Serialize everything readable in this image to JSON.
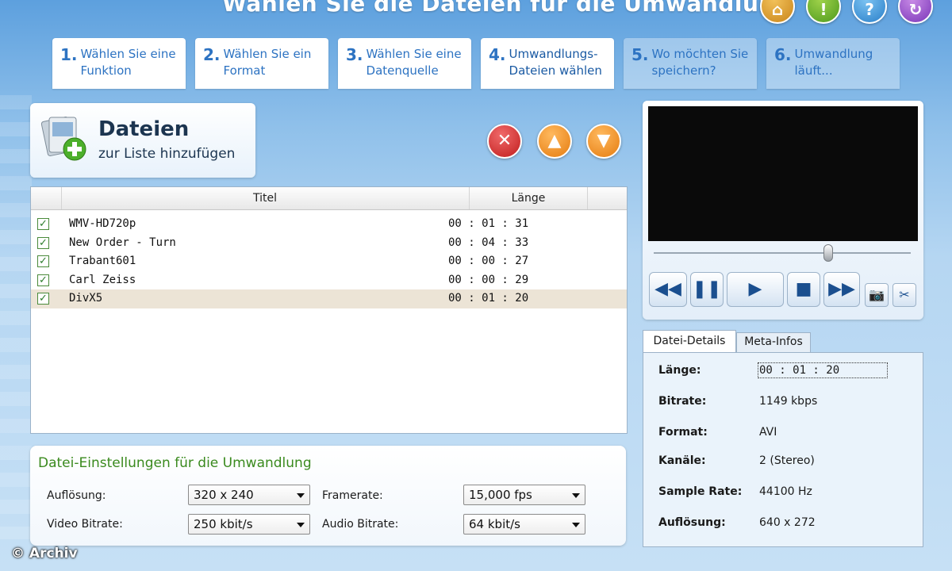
{
  "app": {
    "title": "Wählen Sie die Dateien für die Umwandlung",
    "top_icons": [
      "home-icon",
      "info-icon",
      "help-icon",
      "exit-icon"
    ]
  },
  "steps": [
    {
      "num": "1.",
      "label": "Wählen Sie eine\nFunktion",
      "state": "done"
    },
    {
      "num": "2.",
      "label": "Wählen Sie ein\nFormat",
      "state": "done"
    },
    {
      "num": "3.",
      "label": "Wählen Sie eine\nDatenquelle",
      "state": "done"
    },
    {
      "num": "4.",
      "label": "Umwandlungs-\nDateien wählen",
      "state": "active"
    },
    {
      "num": "5.",
      "label": "Wo möchten Sie\nspeichern?",
      "state": "disabled"
    },
    {
      "num": "6.",
      "label": "Umwandlung\nläuft...",
      "state": "disabled"
    }
  ],
  "add_files": {
    "title": "Dateien",
    "subtitle": "zur Liste hinzufügen"
  },
  "list": {
    "columns": {
      "title": "Titel",
      "length": "Länge"
    },
    "rows": [
      {
        "title": "WMV-HD720p",
        "length": "00 : 01 : 31",
        "checked": true,
        "selected": false
      },
      {
        "title": "New Order - Turn",
        "length": "00 : 04 : 33",
        "checked": true,
        "selected": false
      },
      {
        "title": "Trabant601",
        "length": "00 : 00 : 27",
        "checked": true,
        "selected": false
      },
      {
        "title": "Carl Zeiss",
        "length": "00 : 00 : 29",
        "checked": true,
        "selected": false
      },
      {
        "title": "DivX5",
        "length": "00 : 01 : 20",
        "checked": true,
        "selected": true
      }
    ]
  },
  "settings": {
    "title": "Datei-Einstellungen für die Umwandlung",
    "resolution": {
      "label": "Auflösung:",
      "value": "320 x 240"
    },
    "framerate": {
      "label": "Framerate:",
      "value": "15,000 fps"
    },
    "video_bitrate": {
      "label": "Video Bitrate:",
      "value": "250 kbit/s"
    },
    "audio_bitrate": {
      "label": "Audio Bitrate:",
      "value": "64 kbit/s"
    }
  },
  "player": {
    "seek_position": 0.68,
    "buttons": {
      "rewind": "◀◀",
      "pause": "❚❚",
      "play": "▶",
      "stop": "■",
      "forward": "▶▶",
      "snapshot": "📷",
      "cut": "✂"
    }
  },
  "details": {
    "tabs": [
      "Datei-Details",
      "Meta-Infos"
    ],
    "fields": [
      {
        "key": "Länge:",
        "value": "00 : 01 : 20"
      },
      {
        "key": "Bitrate:",
        "value": "1149 kbps"
      },
      {
        "key": "Format:",
        "value": "AVI"
      },
      {
        "key": "Kanäle:",
        "value": "2 (Stereo)"
      },
      {
        "key": "Sample Rate:",
        "value": "44100 Hz"
      },
      {
        "key": "Auflösung:",
        "value": "640 x 272"
      }
    ]
  },
  "watermark": "© Archiv"
}
